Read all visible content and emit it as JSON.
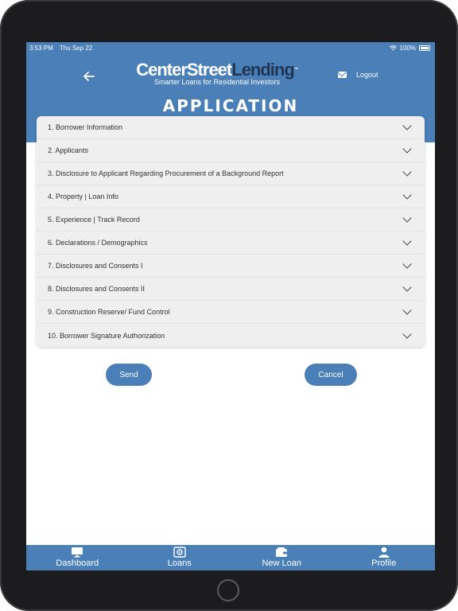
{
  "status_bar": {
    "time": "3:53 PM",
    "date": "Thu Sep 22",
    "battery": "100%"
  },
  "header": {
    "logo_white": "CenterStreet",
    "logo_dark": "Lending",
    "logo_tm": "™",
    "tagline": "Smarter Loans for Residential Investors",
    "logout": "Logout",
    "title": "APPLICATION"
  },
  "sections": [
    "1. Borrower Information",
    "2. Applicants",
    "3. Disclosure to Applicant Regarding Procurement of a Background Report",
    "4. Property | Loan Info",
    "5. Experience | Track Record",
    "6. Declarations / Demographics",
    "7. Disclosures and Consents I",
    "8. Disclosures and Consents II",
    "9. Construction Reserve/ Fund Control",
    "10. Borrower Signature Authorization"
  ],
  "actions": {
    "send": "Send",
    "cancel": "Cancel"
  },
  "tabbar": {
    "dashboard": "Dashboard",
    "loans": "Loans",
    "new_loan": "New Loan",
    "profile": "Profile"
  },
  "colors": {
    "brand_blue": "#4a7fb8",
    "logo_dark": "#1f3552"
  },
  "icons": [
    "back-arrow-icon",
    "mail-icon",
    "chevron-down-icon",
    "dashboard-icon",
    "loans-icon",
    "new-loan-icon",
    "profile-icon"
  ]
}
